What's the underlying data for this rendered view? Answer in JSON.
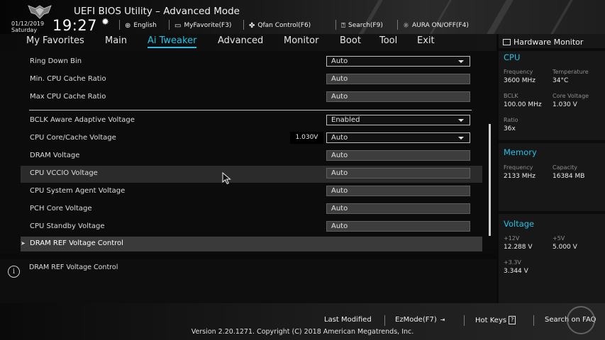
{
  "header": {
    "title": "UEFI BIOS Utility – Advanced Mode",
    "date": "01/12/2019",
    "day": "Saturday",
    "time": "19:27",
    "buttons": [
      {
        "label": "English",
        "icon": "globe-icon"
      },
      {
        "label": "MyFavorite(F3)",
        "icon": "favorite-icon"
      },
      {
        "label": "Qfan Control(F6)",
        "icon": "fan-icon"
      },
      {
        "label": "Search(F9)",
        "icon": "search-icon"
      },
      {
        "label": "AURA ON/OFF(F4)",
        "icon": "aura-icon"
      }
    ]
  },
  "tabs": [
    {
      "label": "My Favorites"
    },
    {
      "label": "Main"
    },
    {
      "label": "Ai Tweaker",
      "active": true
    },
    {
      "label": "Advanced"
    },
    {
      "label": "Monitor"
    },
    {
      "label": "Boot"
    },
    {
      "label": "Tool"
    },
    {
      "label": "Exit"
    }
  ],
  "settings": [
    {
      "label": "Ring Down Bin",
      "value": "Auto"
    },
    {
      "label": "Min. CPU Cache Ratio",
      "value": "Auto"
    },
    {
      "label": "Max CPU Cache Ratio",
      "value": "Auto"
    },
    {
      "label": "BCLK Aware Adaptive Voltage",
      "value": "Enabled"
    },
    {
      "label": "CPU Core/Cache Voltage",
      "value": "Auto",
      "current": "1.030V"
    },
    {
      "label": "DRAM Voltage",
      "value": "Auto"
    },
    {
      "label": "CPU VCCIO Voltage",
      "value": "Auto"
    },
    {
      "label": "CPU System Agent Voltage",
      "value": "Auto"
    },
    {
      "label": "PCH Core Voltage",
      "value": "Auto"
    },
    {
      "label": "CPU Standby Voltage",
      "value": "Auto"
    },
    {
      "label": "DRAM REF Voltage Control"
    }
  ],
  "help": {
    "text": "DRAM REF Voltage Control"
  },
  "hardware_monitor": {
    "title": "Hardware Monitor",
    "cpu": {
      "heading": "CPU",
      "frequency_label": "Frequency",
      "frequency": "3600 MHz",
      "temperature_label": "Temperature",
      "temperature": "34°C",
      "bclk_label": "BCLK",
      "bclk": "100.00 MHz",
      "core_voltage_label": "Core Voltage",
      "core_voltage": "1.030 V",
      "ratio_label": "Ratio",
      "ratio": "36x"
    },
    "memory": {
      "heading": "Memory",
      "frequency_label": "Frequency",
      "frequency": "2133 MHz",
      "capacity_label": "Capacity",
      "capacity": "16384 MB"
    },
    "voltage": {
      "heading": "Voltage",
      "v12_label": "+12V",
      "v12": "12.288 V",
      "v5_label": "+5V",
      "v5": "5.000 V",
      "v33_label": "+3.3V",
      "v33": "3.344 V"
    }
  },
  "footer": {
    "last_modified": "Last Modified",
    "ezmode": "EzMode(F7)",
    "ezmode_key": "⇥",
    "hotkeys": "Hot Keys",
    "hotkeys_key": "?",
    "search_faq": "Search on FAQ",
    "version": "Version 2.20.1271. Copyright (C) 2018 American Megatrends, Inc."
  },
  "colors": {
    "accent": "#27c0e6",
    "background": "#0a0a0a",
    "panel": "#171717"
  }
}
